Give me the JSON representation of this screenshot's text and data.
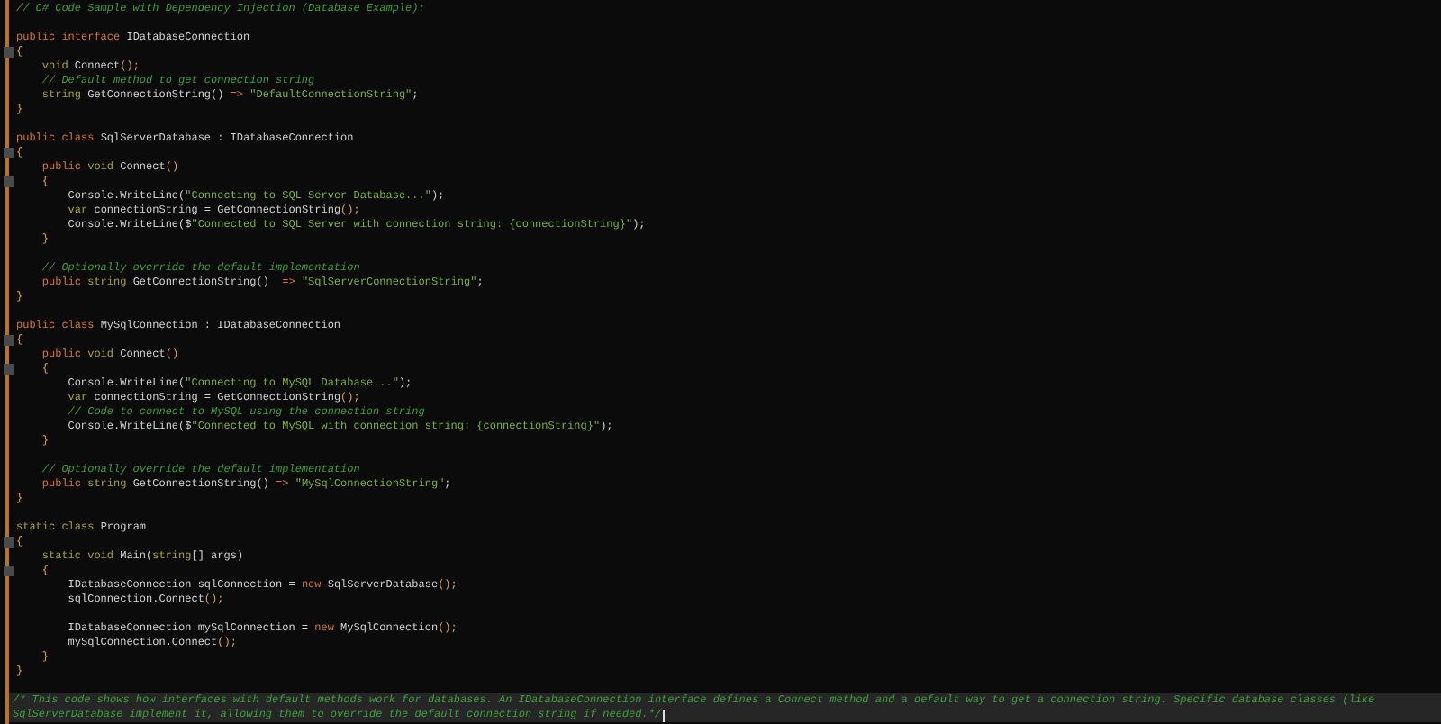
{
  "editor": {
    "lines": [
      {
        "kind": "code",
        "tokens": [
          {
            "kind": "comment",
            "text": "// C# Code Sample with Dependency Injection (Database Example):"
          }
        ]
      },
      {
        "kind": "blank"
      },
      {
        "kind": "code",
        "tokens": [
          {
            "kind": "keyword",
            "text": "public interface "
          },
          {
            "kind": "text",
            "text": "IDatabaseConnection"
          }
        ]
      },
      {
        "kind": "code",
        "fold": true,
        "tokens": [
          {
            "kind": "punct",
            "text": "{"
          }
        ]
      },
      {
        "kind": "code",
        "tokens": [
          {
            "kind": "type",
            "text": "    void "
          },
          {
            "kind": "text",
            "text": "Connect"
          },
          {
            "kind": "punct",
            "text": "();"
          }
        ]
      },
      {
        "kind": "code",
        "tokens": [
          {
            "kind": "comment",
            "text": "    // Default method to get connection string"
          }
        ]
      },
      {
        "kind": "code",
        "tokens": [
          {
            "kind": "type",
            "text": "    string "
          },
          {
            "kind": "text",
            "text": "GetConnectionString() "
          },
          {
            "kind": "keyword",
            "text": "=>"
          },
          {
            "kind": "string",
            "text": " \"DefaultConnectionString\""
          },
          {
            "kind": "text",
            "text": ";"
          }
        ]
      },
      {
        "kind": "code",
        "tokens": [
          {
            "kind": "punct",
            "text": "}"
          }
        ]
      },
      {
        "kind": "blank"
      },
      {
        "kind": "code",
        "tokens": [
          {
            "kind": "keyword",
            "text": "public class "
          },
          {
            "kind": "text",
            "text": "SqlServerDatabase : IDatabaseConnection"
          }
        ]
      },
      {
        "kind": "code",
        "fold": true,
        "tokens": [
          {
            "kind": "punct",
            "text": "{"
          }
        ]
      },
      {
        "kind": "code",
        "tokens": [
          {
            "kind": "keyword",
            "text": "    public "
          },
          {
            "kind": "type",
            "text": "void "
          },
          {
            "kind": "text",
            "text": "Connect"
          },
          {
            "kind": "punct",
            "text": "()"
          }
        ]
      },
      {
        "kind": "code",
        "fold": true,
        "tokens": [
          {
            "kind": "punct",
            "text": "    {"
          }
        ]
      },
      {
        "kind": "code",
        "tokens": [
          {
            "kind": "text",
            "text": "        Console.WriteLine("
          },
          {
            "kind": "string",
            "text": "\"Connecting to SQL Server Database...\""
          },
          {
            "kind": "text",
            "text": ");"
          }
        ]
      },
      {
        "kind": "code",
        "tokens": [
          {
            "kind": "type",
            "text": "        var "
          },
          {
            "kind": "text",
            "text": "connectionString = GetConnectionString"
          },
          {
            "kind": "punct",
            "text": "();"
          }
        ]
      },
      {
        "kind": "code",
        "tokens": [
          {
            "kind": "text",
            "text": "        Console.WriteLine($"
          },
          {
            "kind": "string",
            "text": "\"Connected to SQL Server with connection string: {connectionString}\""
          },
          {
            "kind": "text",
            "text": ");"
          }
        ]
      },
      {
        "kind": "code",
        "tokens": [
          {
            "kind": "punct",
            "text": "    }"
          }
        ]
      },
      {
        "kind": "blank"
      },
      {
        "kind": "code",
        "tokens": [
          {
            "kind": "comment",
            "text": "    // Optionally override the default implementation"
          }
        ]
      },
      {
        "kind": "code",
        "tokens": [
          {
            "kind": "keyword",
            "text": "    public "
          },
          {
            "kind": "type",
            "text": "string "
          },
          {
            "kind": "text",
            "text": "GetConnectionString()  "
          },
          {
            "kind": "keyword",
            "text": "=>"
          },
          {
            "kind": "string",
            "text": " \"SqlServerConnectionString\""
          },
          {
            "kind": "text",
            "text": ";"
          }
        ]
      },
      {
        "kind": "code",
        "tokens": [
          {
            "kind": "punct",
            "text": "}"
          }
        ]
      },
      {
        "kind": "blank"
      },
      {
        "kind": "code",
        "tokens": [
          {
            "kind": "keyword",
            "text": "public class "
          },
          {
            "kind": "text",
            "text": "MySqlConnection : IDatabaseConnection"
          }
        ]
      },
      {
        "kind": "code",
        "fold": true,
        "tokens": [
          {
            "kind": "punct",
            "text": "{"
          }
        ]
      },
      {
        "kind": "code",
        "tokens": [
          {
            "kind": "keyword",
            "text": "    public "
          },
          {
            "kind": "type",
            "text": "void "
          },
          {
            "kind": "text",
            "text": "Connect"
          },
          {
            "kind": "punct",
            "text": "()"
          }
        ]
      },
      {
        "kind": "code",
        "fold": true,
        "tokens": [
          {
            "kind": "punct",
            "text": "    {"
          }
        ]
      },
      {
        "kind": "code",
        "tokens": [
          {
            "kind": "text",
            "text": "        Console.WriteLine("
          },
          {
            "kind": "string",
            "text": "\"Connecting to MySQL Database...\""
          },
          {
            "kind": "text",
            "text": ");"
          }
        ]
      },
      {
        "kind": "code",
        "tokens": [
          {
            "kind": "type",
            "text": "        var "
          },
          {
            "kind": "text",
            "text": "connectionString = GetConnectionString"
          },
          {
            "kind": "punct",
            "text": "();"
          }
        ]
      },
      {
        "kind": "code",
        "tokens": [
          {
            "kind": "comment",
            "text": "        // Code to connect to MySQL using the connection string"
          }
        ]
      },
      {
        "kind": "code",
        "tokens": [
          {
            "kind": "text",
            "text": "        Console.WriteLine($"
          },
          {
            "kind": "string",
            "text": "\"Connected to MySQL with connection string: {connectionString}\""
          },
          {
            "kind": "text",
            "text": ");"
          }
        ]
      },
      {
        "kind": "code",
        "tokens": [
          {
            "kind": "punct",
            "text": "    }"
          }
        ]
      },
      {
        "kind": "blank"
      },
      {
        "kind": "code",
        "tokens": [
          {
            "kind": "comment",
            "text": "    // Optionally override the default implementation"
          }
        ]
      },
      {
        "kind": "code",
        "tokens": [
          {
            "kind": "keyword",
            "text": "    public "
          },
          {
            "kind": "type",
            "text": "string "
          },
          {
            "kind": "text",
            "text": "GetConnectionString() "
          },
          {
            "kind": "keyword",
            "text": "=>"
          },
          {
            "kind": "string",
            "text": " \"MySqlConnectionString\""
          },
          {
            "kind": "text",
            "text": ";"
          }
        ]
      },
      {
        "kind": "code",
        "tokens": [
          {
            "kind": "punct",
            "text": "}"
          }
        ]
      },
      {
        "kind": "blank"
      },
      {
        "kind": "code",
        "tokens": [
          {
            "kind": "type",
            "text": "static class "
          },
          {
            "kind": "text",
            "text": "Program"
          }
        ]
      },
      {
        "kind": "code",
        "fold": true,
        "tokens": [
          {
            "kind": "punct",
            "text": "{"
          }
        ]
      },
      {
        "kind": "code",
        "tokens": [
          {
            "kind": "type",
            "text": "    static void "
          },
          {
            "kind": "text",
            "text": "Main("
          },
          {
            "kind": "type",
            "text": "string"
          },
          {
            "kind": "text",
            "text": "[] args)"
          }
        ]
      },
      {
        "kind": "code",
        "fold": true,
        "tokens": [
          {
            "kind": "punct",
            "text": "    {"
          }
        ]
      },
      {
        "kind": "code",
        "tokens": [
          {
            "kind": "text",
            "text": "        IDatabaseConnection sqlConnection = "
          },
          {
            "kind": "keyword",
            "text": "new "
          },
          {
            "kind": "text",
            "text": "SqlServerDatabase"
          },
          {
            "kind": "punct",
            "text": "();"
          }
        ]
      },
      {
        "kind": "code",
        "tokens": [
          {
            "kind": "text",
            "text": "        sqlConnection.Connect"
          },
          {
            "kind": "punct",
            "text": "();"
          }
        ]
      },
      {
        "kind": "blank"
      },
      {
        "kind": "code",
        "tokens": [
          {
            "kind": "text",
            "text": "        IDatabaseConnection mySqlConnection = "
          },
          {
            "kind": "keyword",
            "text": "new "
          },
          {
            "kind": "text",
            "text": "MySqlConnection"
          },
          {
            "kind": "punct",
            "text": "();"
          }
        ]
      },
      {
        "kind": "code",
        "tokens": [
          {
            "kind": "text",
            "text": "        mySqlConnection.Connect"
          },
          {
            "kind": "punct",
            "text": "();"
          }
        ]
      },
      {
        "kind": "code",
        "tokens": [
          {
            "kind": "punct",
            "text": "    }"
          }
        ]
      },
      {
        "kind": "code",
        "tokens": [
          {
            "kind": "punct",
            "text": "}"
          }
        ]
      },
      {
        "kind": "blank"
      }
    ]
  },
  "highlighted_block": {
    "highlighted": true,
    "lines": [
      "/* This code shows how interfaces with default methods work for databases. An IDatabaseConnection interface defines a Connect method and a default way to get a connection string. Specific database classes (like",
      "SqlServerDatabase implement it, allowing them to override the default connection string if needed.*/"
    ]
  }
}
